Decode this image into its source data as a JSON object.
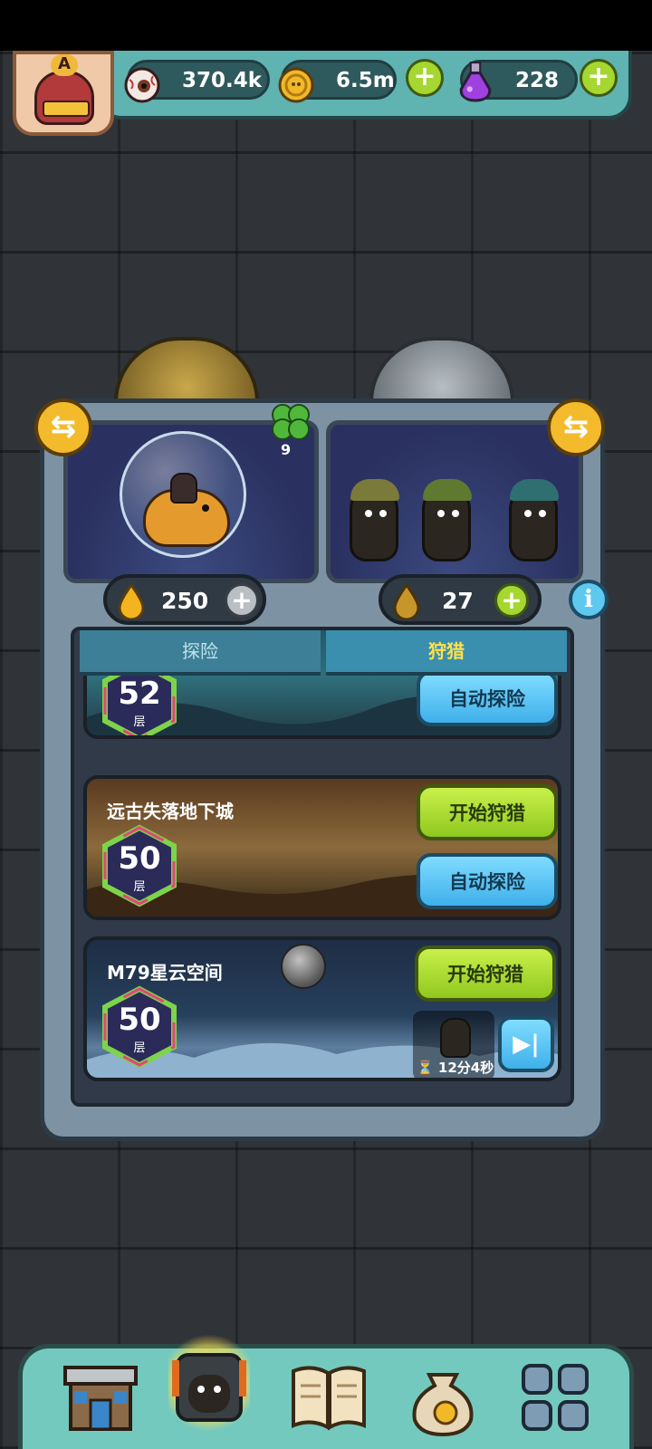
{
  "header": {
    "avatar_letter": "A",
    "eyes": {
      "value": "370.4k",
      "icon": "eyeball-icon"
    },
    "coins": {
      "value": "6.5m",
      "icon": "coin-icon"
    },
    "potions": {
      "value": "228",
      "icon": "potion-flask-icon"
    }
  },
  "machine": {
    "clover_count": "9",
    "left_drop": {
      "value": "250",
      "icon": "gold-drop-icon"
    },
    "right_drop": {
      "value": "27",
      "icon": "amber-drop-icon"
    }
  },
  "tabs": [
    {
      "label": "探险",
      "active": false
    },
    {
      "label": "狩猎",
      "active": true
    }
  ],
  "levels": [
    {
      "title": "",
      "floor": "52",
      "floor_unit": "层",
      "auto_label": "自动探险"
    },
    {
      "title": "远古失落地下城",
      "floor": "50",
      "floor_unit": "层",
      "hunt_label": "开始狩猎",
      "auto_label": "自动探险"
    },
    {
      "title": "M79星云空间",
      "floor": "50",
      "floor_unit": "层",
      "hunt_label": "开始狩猎",
      "timer": "12分4秒"
    }
  ],
  "nav": [
    "shop-building-icon",
    "dungeon-monster-icon",
    "book-icon",
    "coin-sack-icon",
    "grid-menu-icon"
  ],
  "colors": {
    "accent_green": "#a6d630",
    "accent_blue": "#3fb0ea",
    "tab_active_text": "#ffe14d",
    "topbar": "#5fb3b0"
  }
}
